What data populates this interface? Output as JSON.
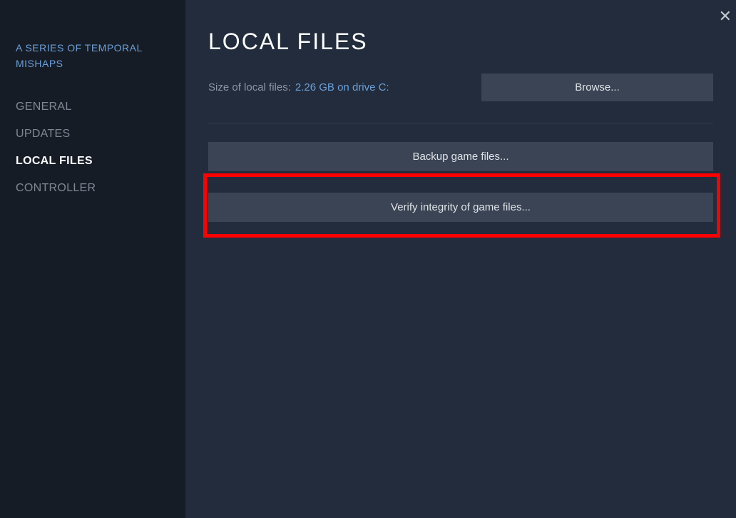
{
  "sidebar": {
    "gameTitle": "A SERIES OF TEMPORAL MISHAPS",
    "items": [
      {
        "label": "GENERAL"
      },
      {
        "label": "UPDATES"
      },
      {
        "label": "LOCAL FILES"
      },
      {
        "label": "CONTROLLER"
      }
    ]
  },
  "main": {
    "title": "LOCAL FILES",
    "sizeLabel": "Size of local files:",
    "sizeValue": "2.26 GB on drive C:",
    "browseLabel": "Browse...",
    "backupLabel": "Backup game files...",
    "verifyLabel": "Verify integrity of game files..."
  },
  "close": "✕"
}
